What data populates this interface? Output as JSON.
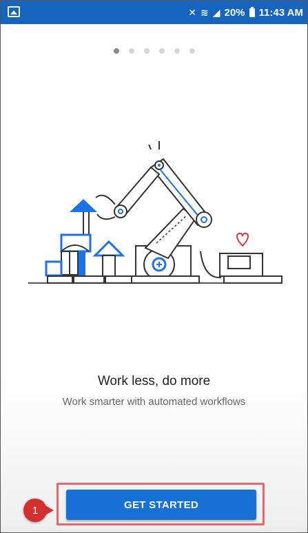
{
  "status_bar": {
    "signal_text": "20%",
    "time": "11:43 AM",
    "mute_icon": "mute-icon",
    "wifi_icon": "wifi-icon",
    "battery_icon": "battery-icon",
    "gallery_icon": "gallery-icon"
  },
  "onboarding": {
    "page_dots_count": 6,
    "active_dot": 1,
    "headline": "Work less, do more",
    "subline": "Work smarter with automated workflows",
    "cta_label": "GET STARTED",
    "step_marker": "1"
  },
  "colors": {
    "status_bar": "#1565c0",
    "cta": "#1670d6",
    "callout": "#d32f2f",
    "highlight_border": "#e26a6a",
    "illustration_accent": "#1a73e8",
    "heart": "#d9363e"
  }
}
